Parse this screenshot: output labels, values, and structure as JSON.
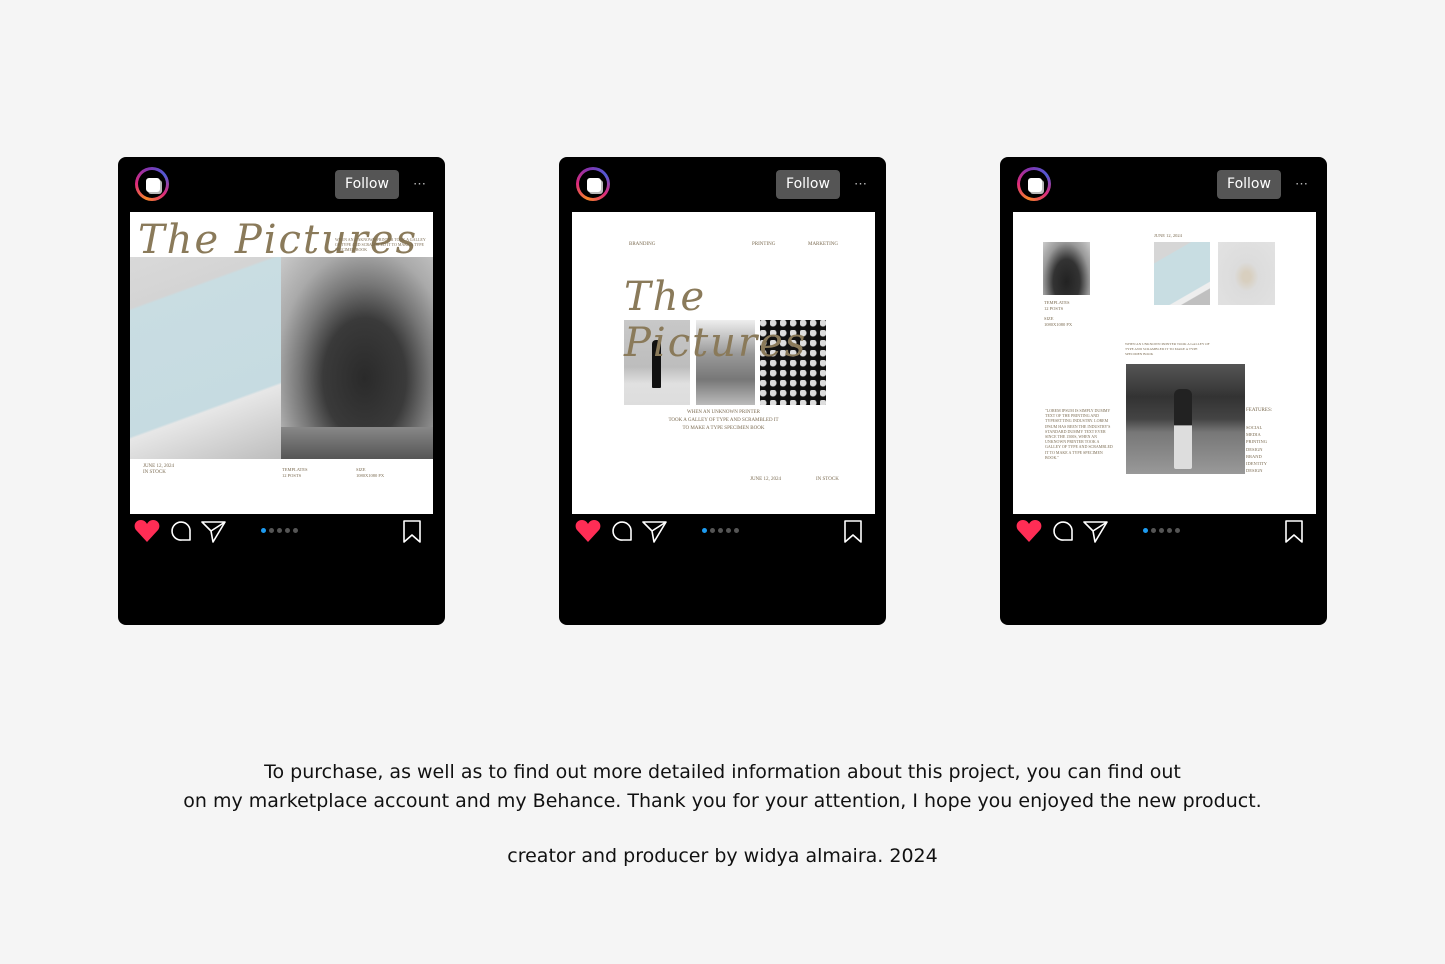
{
  "posts": [
    {
      "follow_label": "Follow",
      "more_icon": "⋯",
      "carousel": {
        "count": 5,
        "active": 1
      },
      "slide": {
        "title": "The Pictures",
        "tagline": "When an unknown printer took a galley of type and scrambled it to make a type specimen book",
        "date": "June 12, 2024",
        "stock": "In stock",
        "templates_label": "Templates",
        "templates_value": "12 posts",
        "size_label": "Size",
        "size_value": "1080x1080 px"
      }
    },
    {
      "follow_label": "Follow",
      "more_icon": "⋯",
      "carousel": {
        "count": 5,
        "active": 1
      },
      "slide": {
        "nav_branding": "Branding",
        "nav_printing": "Printing",
        "nav_marketing": "Marketing",
        "title": "The Pictures",
        "caption_line1": "When an unknown printer",
        "caption_line2": "took a galley of type and scrambled it",
        "caption_line3": "to make a type specimen book",
        "date": "June 12, 2024",
        "stock": "In stock"
      }
    },
    {
      "follow_label": "Follow",
      "more_icon": "⋯",
      "carousel": {
        "count": 5,
        "active": 1
      },
      "slide": {
        "date": "June 12, 2024",
        "templates_label": "Templates",
        "templates_value": "12 posts",
        "size_label": "Size",
        "size_value": "1080x1080 px",
        "tagline": "When an unknown printer took a galley of type and scrambled it to make a type specimen book",
        "quote": "\"Lorem Ipsum is simply dummy text of the printing and typesetting industry. Lorem Ipsum has been the industry's standard dummy text ever since the 1500s, when an unknown printer took a galley of type and scrambled it to make a type specimen book.\"",
        "features_label": "Features:",
        "features": [
          "Social",
          "Media",
          "Printing",
          "Design",
          "Brand",
          "Identity",
          "Design"
        ]
      }
    }
  ],
  "footer": {
    "line1": "To purchase, as well as to find out more detailed information about this project, you can find out",
    "line2": "on my marketplace account and my Behance. Thank you for your attention, I hope you enjoyed the new product.",
    "credit": "creator and producer by widya almaira. 2024"
  },
  "colors": {
    "background": "#f5f5f5",
    "post_frame": "#000000",
    "follow_button": "#555555",
    "like_red": "#ff2d55",
    "carousel_active": "#1d9bf0",
    "accent_text": "#7a6a50"
  }
}
